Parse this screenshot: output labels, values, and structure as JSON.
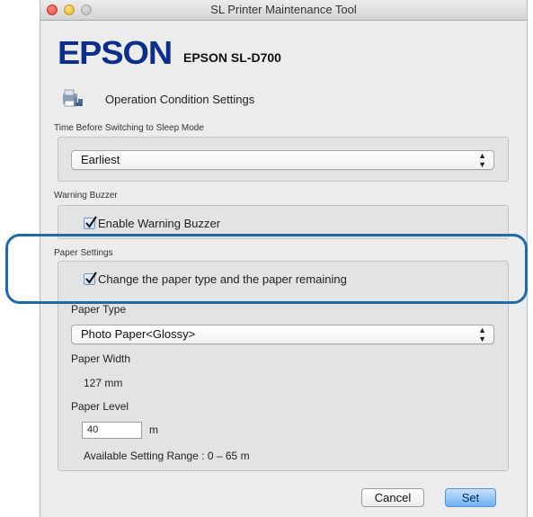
{
  "window": {
    "title": "SL Printer Maintenance Tool"
  },
  "header": {
    "logo": "EPSON",
    "model": "EPSON SL-D700"
  },
  "section": {
    "title": "Operation Condition Settings"
  },
  "sleep": {
    "label": "Time Before Switching to Sleep Mode",
    "selected": "Earliest"
  },
  "buzzer": {
    "label": "Warning Buzzer",
    "checkbox_label": "Enable Warning Buzzer",
    "checked": true
  },
  "paper": {
    "label": "Paper Settings",
    "checkbox_label": "Change the paper type and the paper remaining",
    "checked": true,
    "type_label": "Paper Type",
    "type_selected": "Photo Paper<Glossy>",
    "width_label": "Paper Width",
    "width_value": "127 mm",
    "level_label": "Paper Level",
    "level_value": "40",
    "level_unit": "m",
    "range_text": "Available Setting Range : 0 – 65 m"
  },
  "buttons": {
    "cancel": "Cancel",
    "set": "Set"
  },
  "colors": {
    "highlight": "#1f6aa8",
    "logo": "#0b2f8a",
    "default_button": "#6fb1f5"
  }
}
